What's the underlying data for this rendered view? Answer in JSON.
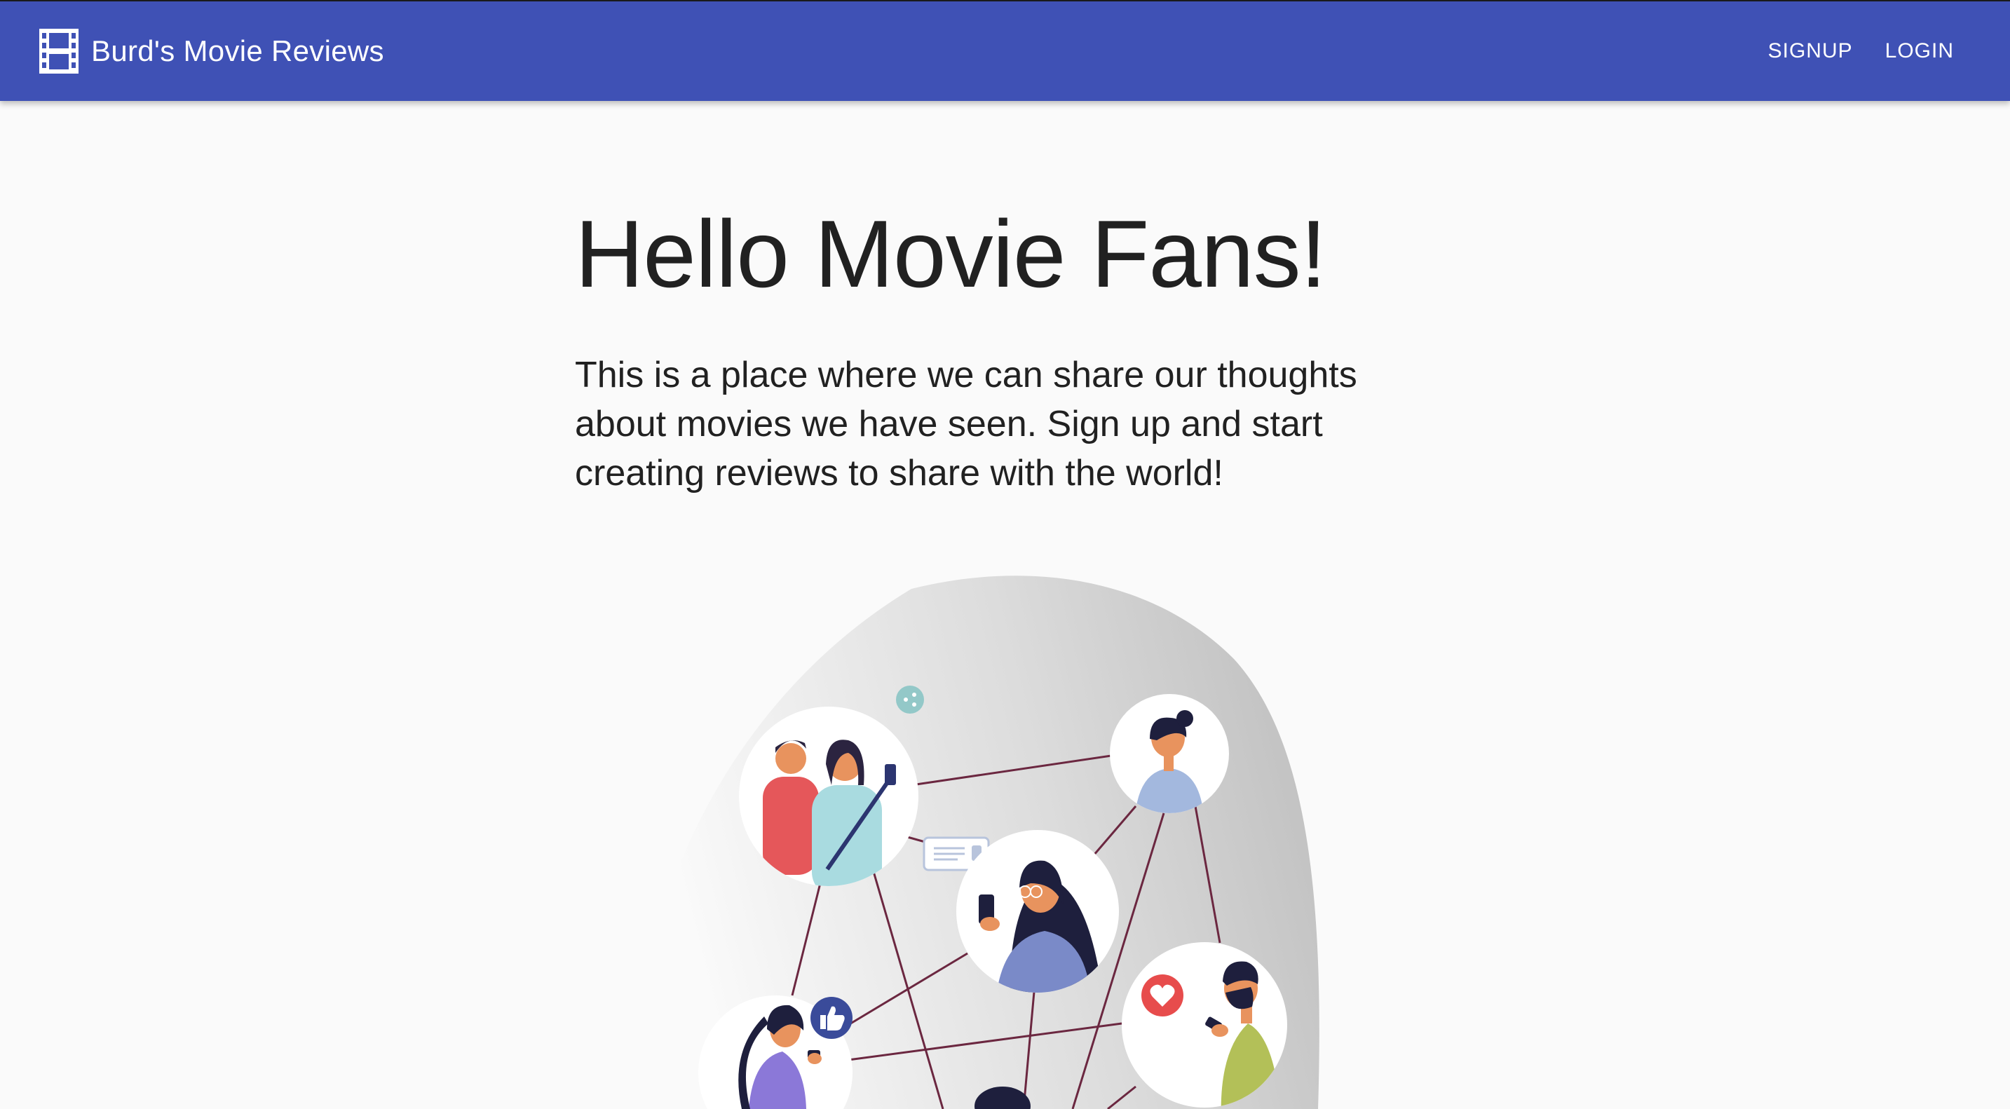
{
  "header": {
    "brand_title": "Burd's Movie Reviews",
    "brand_icon": "film-icon",
    "nav": [
      {
        "label": "SIGNUP"
      },
      {
        "label": "LOGIN"
      }
    ]
  },
  "main": {
    "title": "Hello Movie Fans!",
    "intro": "This is a place where we can share our thoughts about movies we have seen. Sign up and start creating reviews to share with the world!"
  },
  "colors": {
    "appbar": "#3f51b5",
    "background": "#fafafa",
    "text": "#212121",
    "line": "#6b2740",
    "heart": "#e74c4c",
    "thumb": "#3a4b9a"
  }
}
